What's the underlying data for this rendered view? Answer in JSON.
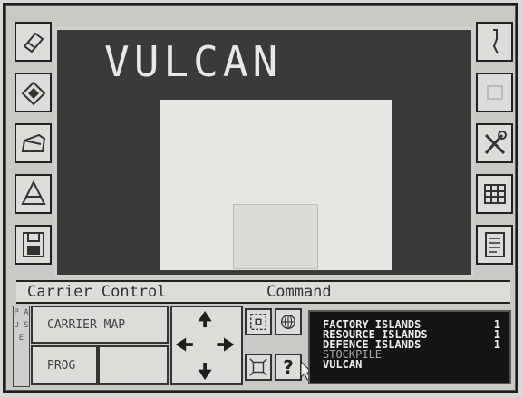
{
  "view": {
    "title": "VULCAN"
  },
  "status": {
    "left": "Carrier Control",
    "right": "Command"
  },
  "side_tab": {
    "label": "P A U S E"
  },
  "buttons": {
    "carrier_map": "CARRIER MAP",
    "prog": "PROG",
    "help": "?"
  },
  "islands": [
    {
      "name": "FACTORY ISLANDS",
      "count": "1",
      "color": "#f0f0f0"
    },
    {
      "name": "RESOURCE ISLANDS",
      "count": "1",
      "color": "#f0f0f0"
    },
    {
      "name": "DEFENCE ISLANDS",
      "count": "1",
      "color": "#f0f0f0"
    },
    {
      "name": "STOCKPILE",
      "count": "",
      "color": "#a8a8a8"
    },
    {
      "name": "VULCAN",
      "count": "",
      "color": "#f0f0f0"
    }
  ],
  "left_icons": [
    "eraser-icon",
    "layers-icon",
    "tank-icon",
    "drawers-icon",
    "floppy-disk-icon"
  ],
  "right_icons": [
    "joystick-icon",
    "blank-icon",
    "tools-icon",
    "grid-icon",
    "document-icon"
  ]
}
